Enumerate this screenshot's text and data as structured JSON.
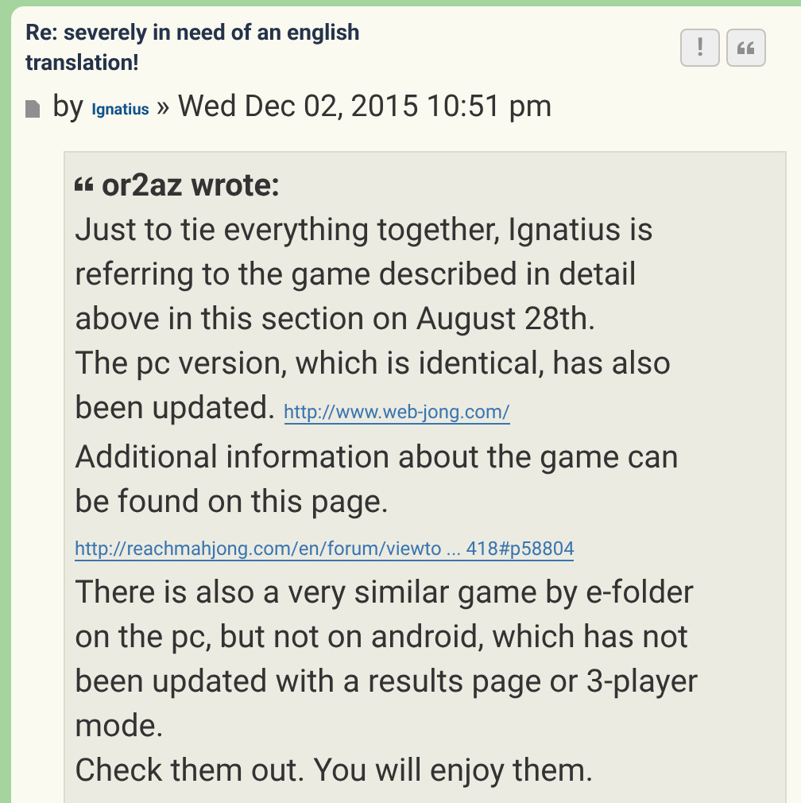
{
  "post": {
    "title": "Re: severely in need of an english translation!",
    "buttons": [
      {
        "label": "!",
        "kind": "report"
      },
      {
        "kind": "quote"
      }
    ],
    "byline": {
      "by": "by",
      "author": "Ignatius",
      "separator": "»",
      "date": "Wed Dec 02, 2015 10:51 pm"
    }
  },
  "quote": {
    "author": "or2az wrote:",
    "paragraphs": [
      {
        "text": "Just to tie everything together, Ignatius is referring to the game described in detail above in this section on August 28th."
      },
      {
        "text": "The pc version, which is identical, has also been updated.",
        "link": "http://www.web-jong.com/"
      },
      {
        "text": "Additional information about the game can be found on this page."
      },
      {
        "link": "http://reachmahjong.com/en/forum/viewto ... 418#p58804"
      },
      {
        "text": "There is also a very similar game by e-folder on the pc, but not on android, which has not been updated with a results page or 3-player mode."
      },
      {
        "text": "Check them out. You will enjoy them."
      }
    ]
  }
}
